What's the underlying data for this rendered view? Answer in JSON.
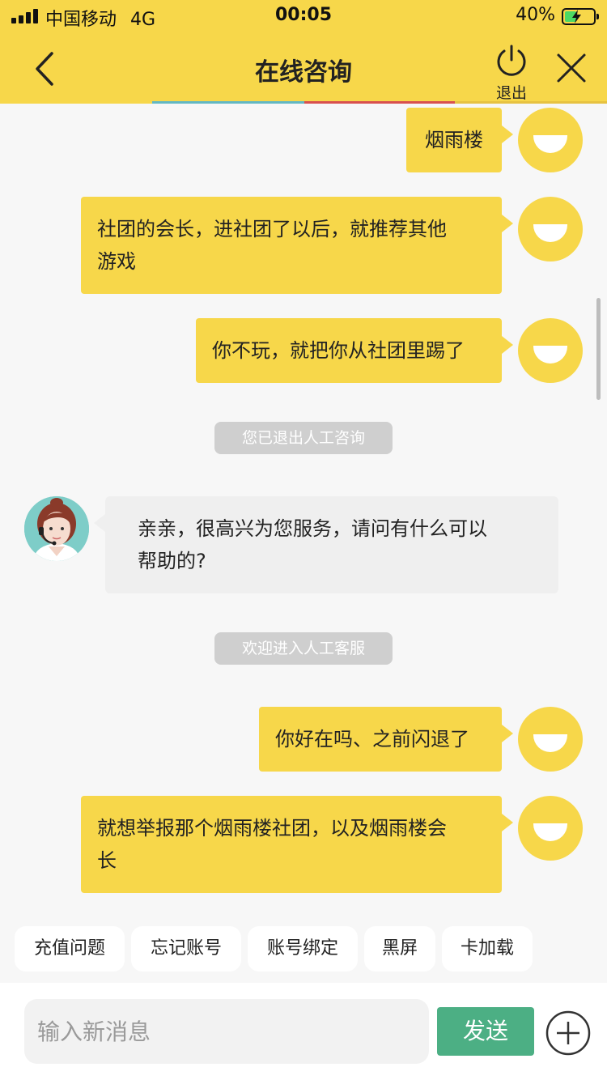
{
  "status_bar": {
    "carrier": "中国移动",
    "network": "4G",
    "time": "00:05",
    "battery_percent": "40%",
    "battery_level": 0.4
  },
  "header": {
    "title": "在线咨询",
    "exit_label": "退出"
  },
  "messages": [
    {
      "type": "user",
      "text": "烟雨楼"
    },
    {
      "type": "user",
      "lines": [
        "社团的会长，进社团了以后，就推荐其他",
        "游戏"
      ]
    },
    {
      "type": "user",
      "text": "你不玩，就把你从社团里踢了"
    },
    {
      "type": "system",
      "text": "您已退出人工咨询"
    },
    {
      "type": "agent",
      "lines": [
        "亲亲，很高兴为您服务，请问有什么可以",
        "帮助的?"
      ]
    },
    {
      "type": "system",
      "text": "欢迎进入人工客服"
    },
    {
      "type": "user",
      "text": "你好在吗、之前闪退了"
    },
    {
      "type": "user",
      "lines": [
        "就想举报那个烟雨楼社团，以及烟雨楼会",
        "长"
      ]
    }
  ],
  "quick_replies": [
    "充值问题",
    "忘记账号",
    "账号绑定",
    "黑屏",
    "卡加载"
  ],
  "input": {
    "placeholder": "输入新消息",
    "send_label": "发送"
  },
  "colors": {
    "brand_yellow": "#f7d74a",
    "send_green": "#4caf84"
  },
  "icons": [
    "signal-icon",
    "battery-icon",
    "back-icon",
    "power-icon",
    "close-icon",
    "plus-icon"
  ]
}
